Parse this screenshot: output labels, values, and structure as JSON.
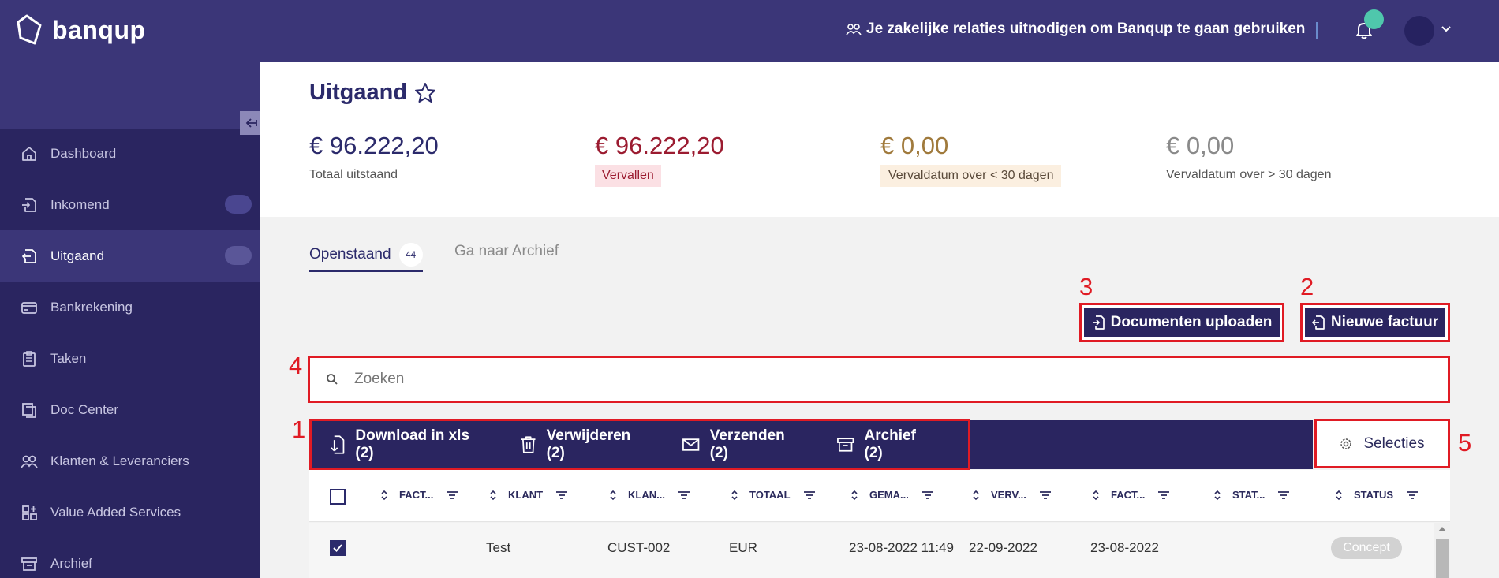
{
  "app": {
    "logo_text": "banqup",
    "invite_text": "Je zakelijke relaties uitnodigen om Banqup te gaan gebruiken"
  },
  "sidebar": {
    "items": [
      {
        "label": "Dashboard",
        "icon": "home-icon"
      },
      {
        "label": "Inkomend",
        "icon": "inbox-icon"
      },
      {
        "label": "Uitgaand",
        "icon": "outbox-icon"
      },
      {
        "label": "Bankrekening",
        "icon": "card-icon"
      },
      {
        "label": "Taken",
        "icon": "clipboard-icon"
      },
      {
        "label": "Doc Center",
        "icon": "documents-icon"
      },
      {
        "label": "Klanten & Leveranciers",
        "icon": "people-icon"
      },
      {
        "label": "Value Added Services",
        "icon": "apps-icon"
      },
      {
        "label": "Archief",
        "icon": "archive-icon"
      }
    ]
  },
  "page": {
    "title": "Uitgaand"
  },
  "stats": [
    {
      "value": "€ 96.222,20",
      "label": "Totaal uitstaand"
    },
    {
      "value": "€ 96.222,20",
      "label": "Vervallen"
    },
    {
      "value": "€ 0,00",
      "label": "Vervaldatum over < 30 dagen"
    },
    {
      "value": "€ 0,00",
      "label": "Vervaldatum over > 30 dagen"
    }
  ],
  "tabs": {
    "open_label": "Openstaand",
    "open_count": "44",
    "archive_label": "Ga naar Archief"
  },
  "buttons": {
    "upload_label": "Documenten uploaden",
    "new_invoice_label": "Nieuwe factuur"
  },
  "markers": {
    "one": "1",
    "two": "2",
    "three": "3",
    "four": "4",
    "five": "5"
  },
  "search": {
    "placeholder": "Zoeken"
  },
  "bulk_actions": {
    "download_label": "Download in xls (2)",
    "delete_label": "Verwijderen (2)",
    "send_label": "Verzenden (2)",
    "archive_label": "Archief (2)",
    "selections_label": "Selecties"
  },
  "table": {
    "columns": [
      "FACT...",
      "KLANT",
      "KLAN...",
      "TOTAAL",
      "GEMA...",
      "VERV...",
      "FACT...",
      "STAT...",
      "STATUS"
    ],
    "rows": [
      {
        "factuur": "",
        "klant": "Test",
        "klantnummer": "CUST-002",
        "totaal": "EUR",
        "gemaakt": "23-08-2022 11:49",
        "vervaldatum": "22-09-2022",
        "factuurdatum": "23-08-2022",
        "stat": "",
        "status": "Concept"
      }
    ]
  },
  "colors": {
    "topbar": "#3b3678",
    "sidebar": "#2a2560",
    "accent": "#2b2a6b",
    "highlight_border": "#e01b24",
    "overdue": "#9b1b30",
    "upcoming": "#a07a3c",
    "notification": "#4fc7ac"
  }
}
